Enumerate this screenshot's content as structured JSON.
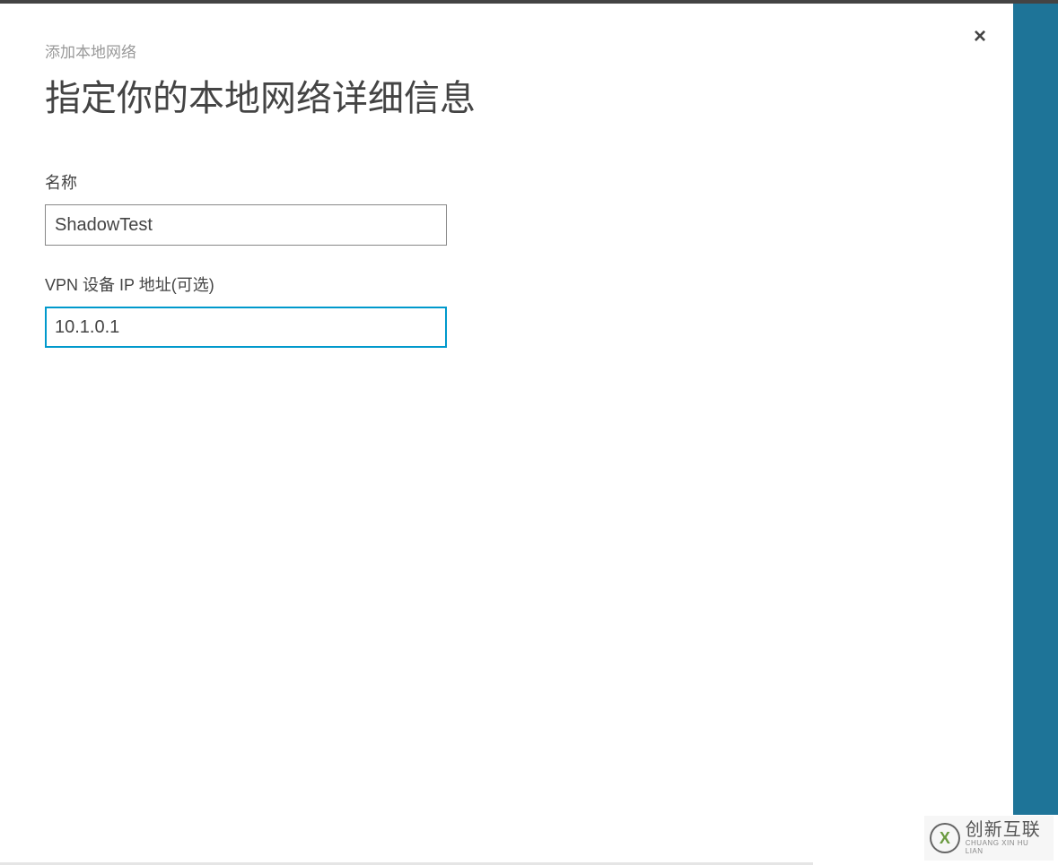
{
  "modal": {
    "breadcrumb": "添加本地网络",
    "title": "指定你的本地网络详细信息",
    "close_label": "×"
  },
  "form": {
    "name": {
      "label": "名称",
      "value": "ShadowTest"
    },
    "vpn_ip": {
      "label": "VPN 设备 IP 地址(可选)",
      "value": "10.1.0.1"
    }
  },
  "watermark": {
    "icon_text": "X",
    "main_text": "创新互联",
    "sub_text": "CHUANG XIN HU LIAN"
  },
  "colors": {
    "accent": "#0099cc",
    "right_panel": "#1e7498",
    "text_primary": "#444444",
    "text_muted": "#999999"
  }
}
